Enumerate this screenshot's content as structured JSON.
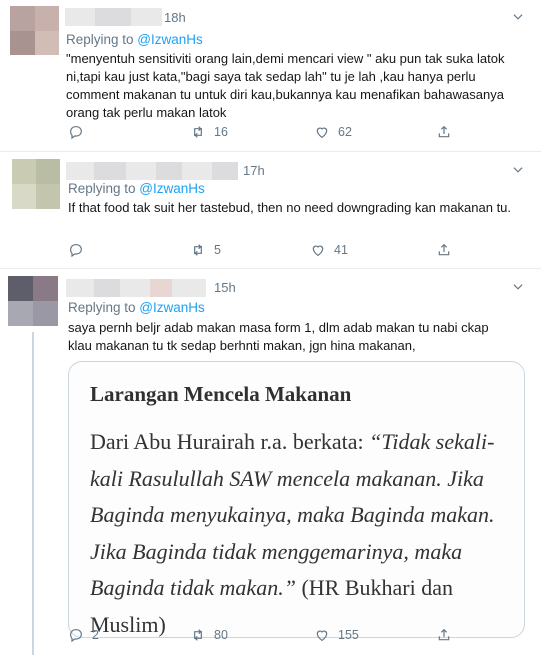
{
  "tweets": [
    {
      "time": "18h",
      "replying_prefix": "Replying to ",
      "replying_handle": "@IzwanHs",
      "text": "\"menyentuh sensitiviti orang lain,demi mencari view \" aku pun tak suka latok ni,tapi kau just kata,\"bagi saya tak sedap lah\" tu je lah ,kau hanya perlu comment makanan tu untuk diri kau,bukannya kau menafikan bahawasanya orang tak perlu makan latok",
      "replies": "",
      "retweets": "16",
      "likes": "62"
    },
    {
      "time": "17h",
      "replying_prefix": "Replying to ",
      "replying_handle": "@IzwanHs",
      "text": "If that food tak suit her tastebud, then no need downgrading kan makanan tu.",
      "replies": "",
      "retweets": "5",
      "likes": "41"
    },
    {
      "time": "15h",
      "replying_prefix": "Replying to ",
      "replying_handle": "@IzwanHs",
      "text": "saya pernh beljr adab makan masa form 1, dlm adab makan tu nabi ckap klau makanan tu tk sedap berhnti makan, jgn hina makanan,",
      "replies": "2",
      "retweets": "80",
      "likes": "155",
      "card": {
        "title": "Larangan Mencela Makanan",
        "lead": "Dari Abu Hurairah r.a. berkata: ",
        "quote": "“Tidak sekali-kali Rasulullah SAW mencela makanan. Jika Baginda menyukainya, maka Baginda makan. Jika Baginda tidak menggemarinya, maka Baginda tidak makan.”",
        "source": " (HR Bukhari dan Muslim)"
      }
    }
  ],
  "colors": {
    "accent": "#1da1f2",
    "secondary_text": "#657786",
    "border": "#e6ecf0"
  },
  "icons": [
    "reply-icon",
    "retweet-icon",
    "like-icon",
    "share-icon",
    "chevron-down-icon"
  ]
}
